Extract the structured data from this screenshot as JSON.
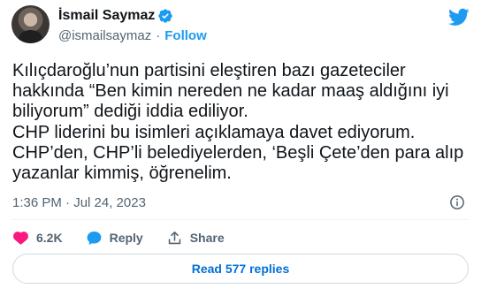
{
  "author": {
    "name": "İsmail Saymaz",
    "handle": "@ismailsaymaz",
    "separator": "·",
    "follow_label": "Follow"
  },
  "tweet": {
    "lines": [
      "Kılıçdaroğlu’nun partisini eleştiren bazı gazeteciler",
      "hakkında “Ben kimin nereden ne kadar maaş aldığını iyi",
      "biliyorum” dediği iddia ediliyor.",
      "CHP liderini bu isimleri açıklamaya davet ediyorum.",
      "CHP’den, CHP’li belediyelerden, ‘Beşli Çete’den para alıp",
      "yazanlar kimmiş, öğrenelim."
    ],
    "timestamp": "1:36 PM · Jul 24, 2023"
  },
  "actions": {
    "likes": "6.2K",
    "reply_label": "Reply",
    "share_label": "Share"
  },
  "read_replies_label": "Read 577 replies",
  "colors": {
    "accent": "#1d9bf0",
    "like": "#f91880",
    "link": "#006fd6",
    "muted": "#536471"
  },
  "icons": [
    "verified-badge-icon",
    "twitter-bird-icon",
    "info-icon",
    "heart-icon",
    "reply-icon",
    "share-icon"
  ]
}
